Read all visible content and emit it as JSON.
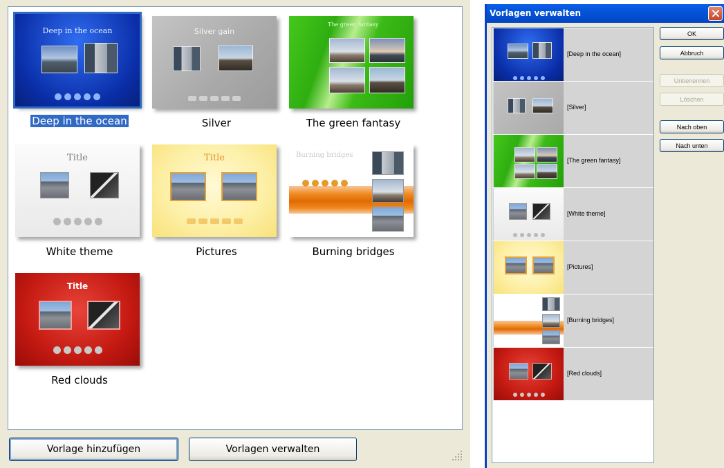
{
  "gallery": {
    "templates": [
      {
        "label": "Deep in the ocean",
        "thumb_title": "Deep in the ocean",
        "selected": true
      },
      {
        "label": "Silver",
        "thumb_title": "Silver gain",
        "selected": false
      },
      {
        "label": "The green fantasy",
        "thumb_title": "The green fantasy",
        "selected": false
      },
      {
        "label": "White theme",
        "thumb_title": "Title",
        "selected": false
      },
      {
        "label": "Pictures",
        "thumb_title": "Title",
        "selected": false
      },
      {
        "label": "Burning bridges",
        "thumb_title": "Burning bridges",
        "selected": false
      },
      {
        "label": "Red clouds",
        "thumb_title": "Title",
        "selected": false
      }
    ]
  },
  "buttons": {
    "add_template": "Vorlage hinzufügen",
    "manage_templates": "Vorlagen verwalten"
  },
  "dialog": {
    "title": "Vorlagen verwalten",
    "list_items": [
      "[Deep in the ocean]",
      "[Silver]",
      "[The green fantasy]",
      "[White theme]",
      "[Pictures]",
      "[Burning bridges]",
      "[Red clouds]"
    ],
    "ok": "OK",
    "cancel": "Abbruch",
    "rename": "Unbenennen",
    "delete": "Löschen",
    "move_up": "Nach oben",
    "move_down": "Nach unten"
  },
  "colors": {
    "selection": "#316ac5",
    "titlebar": "#0453d9",
    "window_bg": "#ece9d8"
  },
  "icons": [
    "close-icon",
    "resize-grip-icon"
  ]
}
